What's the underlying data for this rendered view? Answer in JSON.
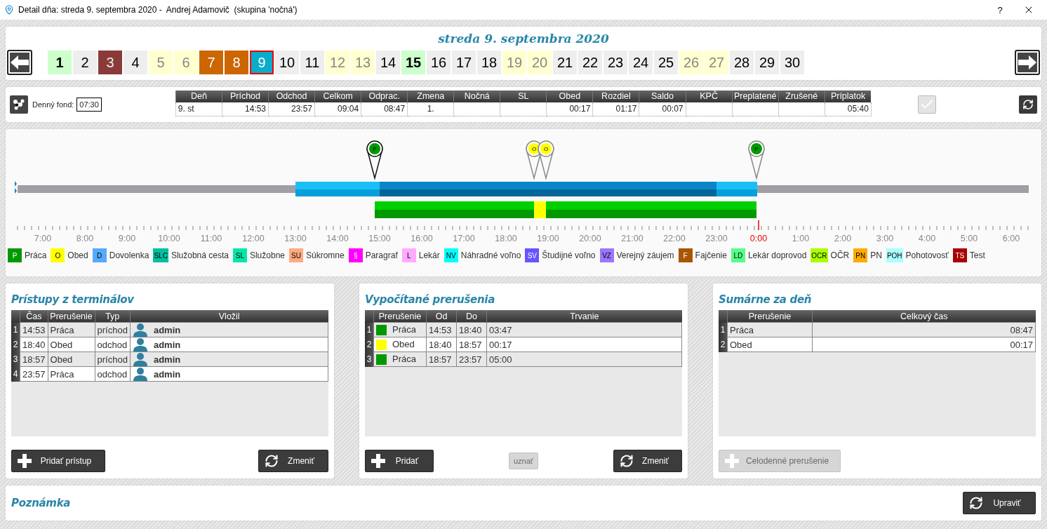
{
  "window": {
    "title": "Detail dňa: streda 9. septembra 2020 -  Andrej Adamovič  (skupina 'nočná')",
    "help": "?"
  },
  "calendar": {
    "heading": "streda 9. septembra 2020",
    "days": [
      {
        "label": "1",
        "kind": "green",
        "selected": false
      },
      {
        "label": "2",
        "kind": "normal",
        "selected": false
      },
      {
        "label": "3",
        "kind": "red",
        "selected": false
      },
      {
        "label": "4",
        "kind": "normal",
        "selected": false
      },
      {
        "label": "5",
        "kind": "weekend",
        "selected": false
      },
      {
        "label": "6",
        "kind": "weekend",
        "selected": false
      },
      {
        "label": "7",
        "kind": "orange",
        "selected": false
      },
      {
        "label": "8",
        "kind": "orange",
        "selected": false
      },
      {
        "label": "9",
        "kind": "normal",
        "selected": true
      },
      {
        "label": "10",
        "kind": "normal",
        "selected": false
      },
      {
        "label": "11",
        "kind": "normal",
        "selected": false
      },
      {
        "label": "12",
        "kind": "weekend",
        "selected": false
      },
      {
        "label": "13",
        "kind": "weekend",
        "selected": false
      },
      {
        "label": "14",
        "kind": "normal",
        "selected": false
      },
      {
        "label": "15",
        "kind": "green",
        "selected": false
      },
      {
        "label": "16",
        "kind": "normal",
        "selected": false
      },
      {
        "label": "17",
        "kind": "normal",
        "selected": false
      },
      {
        "label": "18",
        "kind": "normal",
        "selected": false
      },
      {
        "label": "19",
        "kind": "weekend",
        "selected": false
      },
      {
        "label": "20",
        "kind": "weekend",
        "selected": false
      },
      {
        "label": "21",
        "kind": "normal",
        "selected": false
      },
      {
        "label": "22",
        "kind": "normal",
        "selected": false
      },
      {
        "label": "23",
        "kind": "normal",
        "selected": false
      },
      {
        "label": "24",
        "kind": "normal",
        "selected": false
      },
      {
        "label": "25",
        "kind": "normal",
        "selected": false
      },
      {
        "label": "26",
        "kind": "weekend",
        "selected": false
      },
      {
        "label": "27",
        "kind": "weekend",
        "selected": false
      },
      {
        "label": "28",
        "kind": "normal",
        "selected": false
      },
      {
        "label": "29",
        "kind": "normal",
        "selected": false
      },
      {
        "label": "30",
        "kind": "normal",
        "selected": false
      }
    ]
  },
  "day_summary": {
    "fund_label": "Denný fond:",
    "fund_value": "07:30",
    "confirm_disabled": true,
    "columns": [
      "Deň",
      "Príchod",
      "Odchod",
      "Celkom",
      "Odprac.",
      "Zmena",
      "Nočná",
      "SL",
      "Obed",
      "Rozdiel",
      "Saldo",
      "KPČ",
      "Preplatené",
      "Zrušené",
      "Príplatok"
    ],
    "row": [
      {
        "text": "9. st",
        "kind": "left"
      },
      {
        "text": "14:53",
        "kind": "right"
      },
      {
        "text": "23:57",
        "kind": "right"
      },
      {
        "text": "09:04",
        "kind": "right"
      },
      {
        "text": "08:47",
        "kind": "right"
      },
      {
        "text": "1.",
        "kind": "center"
      },
      {
        "kind": "right"
      },
      {
        "kind": "right"
      },
      {
        "text": "00:17",
        "kind": "right"
      },
      {
        "text": "01:17",
        "kind": "right"
      },
      {
        "text": "00:07",
        "kind": "right"
      },
      {
        "kind": "right"
      },
      {
        "kind": "right"
      },
      {
        "kind": "right"
      },
      {
        "text": "05:40",
        "kind": "right"
      }
    ]
  },
  "timeline": {
    "axis_labels": [
      {
        "label": "7:00",
        "current": false
      },
      {
        "label": "8:00",
        "current": false
      },
      {
        "label": "9:00",
        "current": false
      },
      {
        "label": "10:00",
        "current": false
      },
      {
        "label": "11:00",
        "current": false
      },
      {
        "label": "12:00",
        "current": false
      },
      {
        "label": "13:00",
        "current": false
      },
      {
        "label": "14:00",
        "current": false
      },
      {
        "label": "15:00",
        "current": false
      },
      {
        "label": "16:00",
        "current": false
      },
      {
        "label": "17:00",
        "current": false
      },
      {
        "label": "18:00",
        "current": false
      },
      {
        "label": "19:00",
        "current": false
      },
      {
        "label": "20:00",
        "current": false
      },
      {
        "label": "21:00",
        "current": false
      },
      {
        "label": "22:00",
        "current": false
      },
      {
        "label": "23:00",
        "current": false
      },
      {
        "label": "0:00",
        "current": true
      },
      {
        "label": "1:00",
        "current": false
      },
      {
        "label": "2:00",
        "current": false
      },
      {
        "label": "3:00",
        "current": false
      },
      {
        "label": "4:00",
        "current": false
      },
      {
        "label": "5:00",
        "current": false
      },
      {
        "label": "6:00",
        "current": false
      }
    ],
    "markers": [
      {
        "code": "P",
        "color": "#009900"
      },
      {
        "code": "O",
        "color": "#ffff00"
      },
      {
        "code": "O",
        "color": "#ffff00"
      },
      {
        "code": "P",
        "color": "#009900"
      }
    ]
  },
  "legend": [
    {
      "code": "P",
      "label": "Práca",
      "color": "#009900"
    },
    {
      "code": "O",
      "label": "Obed",
      "color": "#ffff00"
    },
    {
      "code": "D",
      "label": "Dovolenka",
      "color": "#55aaff"
    },
    {
      "code": "SLC",
      "label": "Služobná cesta",
      "color": "#00c0a0"
    },
    {
      "code": "SL",
      "label": "Služobne",
      "color": "#00e8a8"
    },
    {
      "code": "SU",
      "label": "Súkromne",
      "color": "#ffaa80"
    },
    {
      "code": "§",
      "label": "Paragraf",
      "color": "#ff00ff"
    },
    {
      "code": "L",
      "label": "Lekár",
      "color": "#ffaaff"
    },
    {
      "code": "NV",
      "label": "Náhradné voľno",
      "color": "#00ffff"
    },
    {
      "code": "SV",
      "label": "Študijné voľno",
      "color": "#6655ff"
    },
    {
      "code": "VZ",
      "label": "Verejný záujem",
      "color": "#9977ff"
    },
    {
      "code": "F",
      "label": "Fajčenie",
      "color": "#aa5500"
    },
    {
      "code": "LD",
      "label": "Lekár doprovod",
      "color": "#55ff88"
    },
    {
      "code": "OCR",
      "label": "OČR",
      "color": "#aaff00"
    },
    {
      "code": "PN",
      "label": "PN",
      "color": "#ffaa00"
    },
    {
      "code": "POH",
      "label": "Pohotovosť",
      "color": "#aaffff"
    },
    {
      "code": "TS",
      "label": "Test",
      "color": "#aa0000"
    }
  ],
  "accesses": {
    "title": "Prístupy z terminálov",
    "columns": [
      "Čas",
      "Prerušenie",
      "Typ",
      "Vložil"
    ],
    "rows": [
      {
        "number": "1",
        "time": "14:53",
        "name": "Práca",
        "direction": "príchod",
        "user": "admin"
      },
      {
        "number": "2",
        "time": "18:40",
        "name": "Obed",
        "direction": "odchod",
        "user": "admin"
      },
      {
        "number": "3",
        "time": "18:57",
        "name": "Obed",
        "direction": "príchod",
        "user": "admin"
      },
      {
        "number": "4",
        "time": "23:57",
        "name": "Práca",
        "direction": "odchod",
        "user": "admin"
      }
    ],
    "buttons": [
      {
        "label": "Pridať prístup",
        "kind": "add",
        "disabled": false
      },
      {
        "label": "Zmeniť",
        "kind": "refresh",
        "disabled": false
      }
    ]
  },
  "breaks": {
    "title": "Vypočítané prerušenia",
    "columns": [
      "Prerušenie",
      "Od",
      "Do",
      "Trvanie"
    ],
    "rows": [
      {
        "number": "1",
        "color": "#009900",
        "name": "Práca",
        "from": "14:53",
        "to": "18:40",
        "duration": "03:47"
      },
      {
        "number": "2",
        "color": "#ffff00",
        "name": "Obed",
        "from": "18:40",
        "to": "18:57",
        "duration": "00:17"
      },
      {
        "number": "3",
        "color": "#009900",
        "name": "Práca",
        "from": "18:57",
        "to": "23:57",
        "duration": "05:00"
      }
    ],
    "buttons": [
      {
        "label": "Pridať",
        "kind": "add",
        "disabled": false
      },
      {
        "label": "uznať",
        "kind": "plain",
        "disabled": true
      },
      {
        "label": "Zmeniť",
        "kind": "refresh",
        "disabled": false
      }
    ]
  },
  "summary": {
    "title": "Sumárne za deň",
    "columns": [
      "Prerušenie",
      "Celkový čas"
    ],
    "rows": [
      {
        "number": "1",
        "name": "Práca",
        "total": "08:47"
      },
      {
        "number": "2",
        "name": "Obed",
        "total": "00:17"
      }
    ],
    "buttons": [
      {
        "label": "Celodenné prerušenie",
        "kind": "add",
        "disabled": true
      }
    ]
  },
  "note": {
    "title": "Poznámka",
    "buttons": [
      {
        "label": "Upraviť",
        "kind": "refresh",
        "disabled": false
      }
    ]
  }
}
